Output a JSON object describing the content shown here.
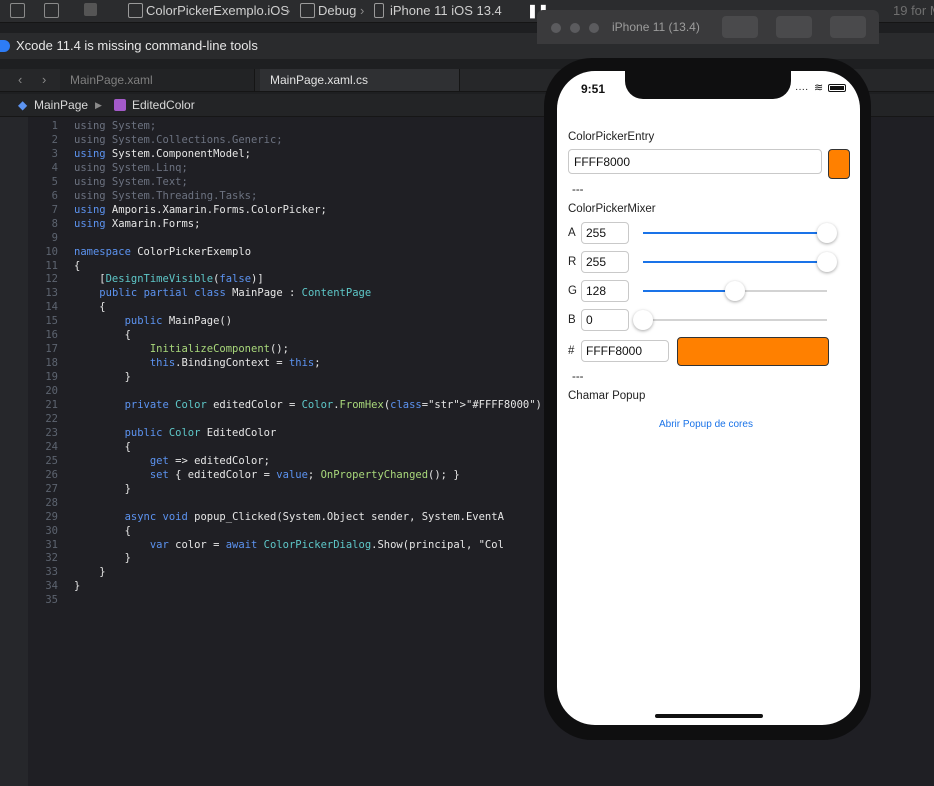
{
  "toolbar": {
    "scheme": "ColorPickerExemplo.iOS",
    "config": "Debug",
    "device": "iPhone 11 iOS 13.4",
    "right_text": "19 for M"
  },
  "warning": {
    "text": "Xcode 11.4 is missing command-line tools"
  },
  "tabs": [
    {
      "label": "MainPage.xaml"
    },
    {
      "label": "MainPage.xaml.cs"
    }
  ],
  "jumpbar": {
    "class_name": "MainPage",
    "member_name": "EditedColor"
  },
  "simulator": {
    "title": "iPhone 11 (13.4)"
  },
  "phone": {
    "time": "9:51",
    "entry_label": "ColorPickerEntry",
    "entry_value": "FFFF8000",
    "sep1": "---",
    "mixer_label": "ColorPickerMixer",
    "channels": [
      {
        "name": "A",
        "value": "255",
        "level": 1.0
      },
      {
        "name": "R",
        "value": "255",
        "level": 1.0
      },
      {
        "name": "G",
        "value": "128",
        "level": 0.5
      },
      {
        "name": "B",
        "value": "0",
        "level": 0.0
      }
    ],
    "hex_prefix": "#",
    "hex_value": "FFFF8000",
    "swatch_color": "#FF8000",
    "sep2": "---",
    "popup_label": "Chamar Popup",
    "popup_link": "Abrir Popup de cores"
  },
  "editor": {
    "line_numbers": [
      "1",
      "2",
      "3",
      "4",
      "5",
      "6",
      "7",
      "8",
      "9",
      "10",
      "11",
      "12",
      "13",
      "14",
      "15",
      "16",
      "17",
      "18",
      "19",
      "20",
      "21",
      "22",
      "23",
      "24",
      "25",
      "26",
      "27",
      "28",
      "29",
      "30",
      "31",
      "32",
      "33",
      "34",
      "35"
    ],
    "lines": [
      "using System;",
      "using System.Collections.Generic;",
      "using System.ComponentModel;",
      "using System.Linq;",
      "using System.Text;",
      "using System.Threading.Tasks;",
      "using Amporis.Xamarin.Forms.ColorPicker;",
      "using Xamarin.Forms;",
      "",
      "namespace ColorPickerExemplo",
      "{",
      "    [DesignTimeVisible(false)]",
      "    public partial class MainPage : ContentPage",
      "    {",
      "        public MainPage()",
      "        {",
      "            InitializeComponent();",
      "            this.BindingContext = this;",
      "        }",
      "",
      "        private Color editedColor = Color.FromHex(\"#FFFF8000\");",
      "",
      "        public Color EditedColor",
      "        {",
      "            get => editedColor;",
      "            set { editedColor = value; OnPropertyChanged(); }",
      "        }",
      "",
      "        async void popup_Clicked(System.Object sender, System.EventA",
      "        {",
      "            var color = await ColorPickerDialog.Show(principal, \"Col",
      "        }",
      "    }",
      "}",
      ""
    ]
  }
}
